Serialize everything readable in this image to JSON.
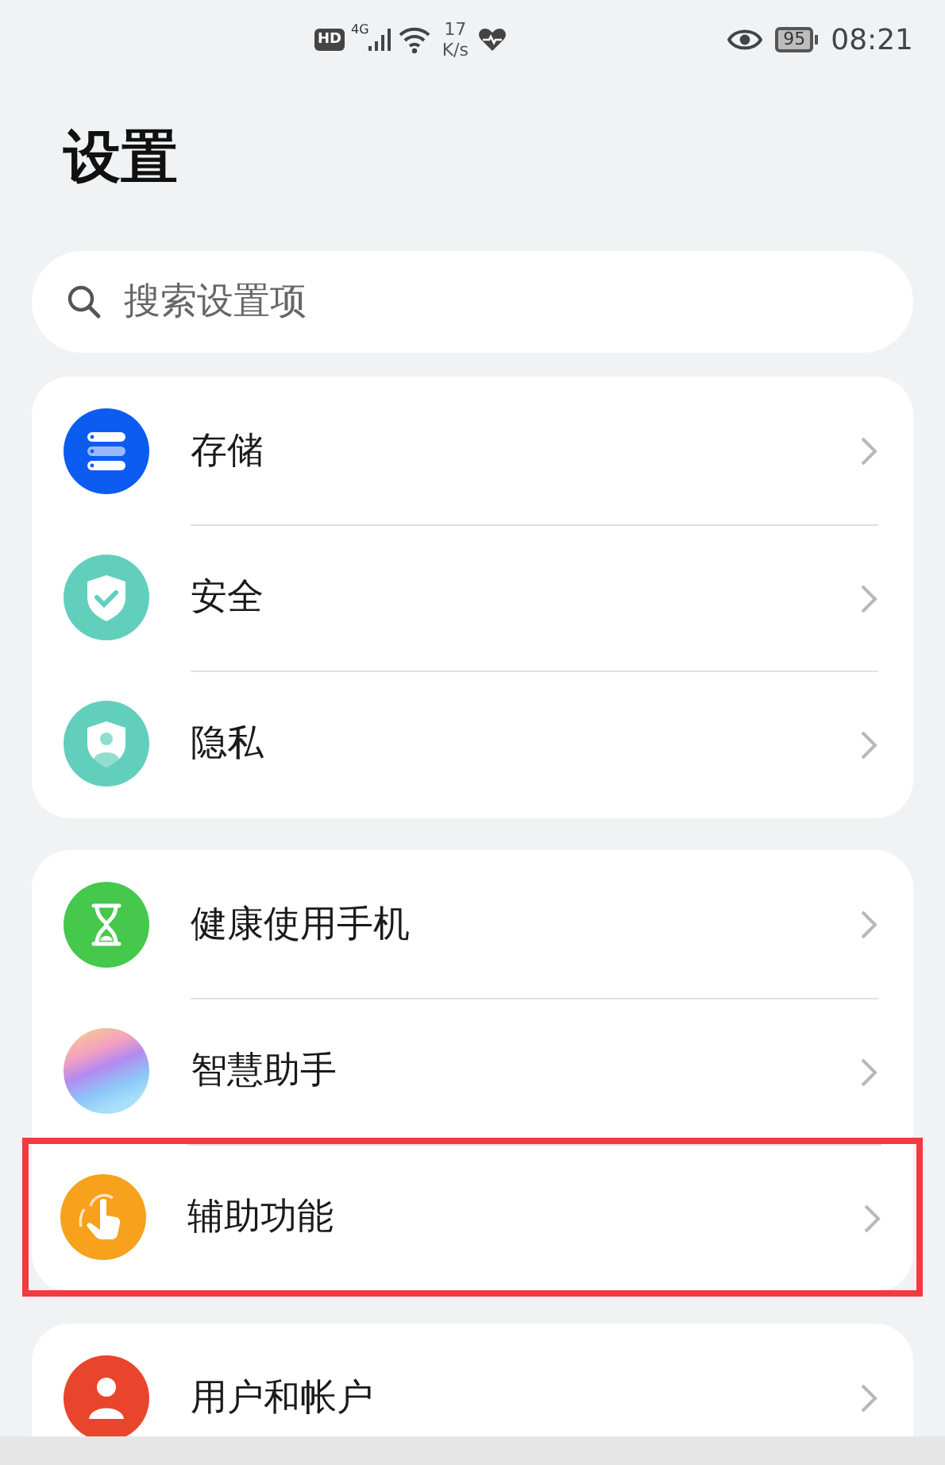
{
  "status_bar": {
    "hd": "HD",
    "network": "4G",
    "speed_value": "17",
    "speed_unit": "K/s",
    "battery": "95",
    "time": "08:21"
  },
  "title": "设置",
  "search": {
    "placeholder": "搜索设置项"
  },
  "groups": [
    {
      "items": [
        {
          "label": "存储",
          "highlighted": false
        },
        {
          "label": "安全",
          "highlighted": false
        },
        {
          "label": "隐私",
          "highlighted": false
        }
      ]
    },
    {
      "items": [
        {
          "label": "健康使用手机",
          "highlighted": false
        },
        {
          "label": "智慧助手",
          "highlighted": false
        },
        {
          "label": "辅助功能",
          "highlighted": true
        }
      ]
    },
    {
      "items": [
        {
          "label": "用户和帐户",
          "highlighted": false
        }
      ]
    }
  ]
}
